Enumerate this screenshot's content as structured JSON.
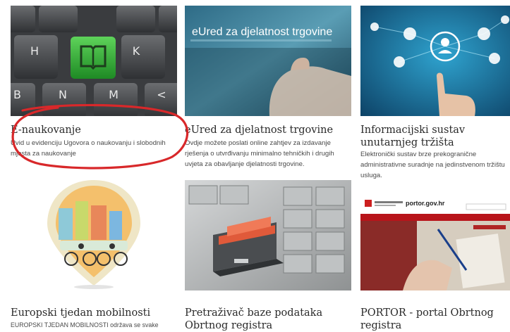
{
  "cards": [
    {
      "title": "E-naukovanje",
      "desc": "Uvid u evidenciju Ugovora o naukovanju i slobodnih mjesta za naukovanje",
      "keys": [
        "H",
        "K",
        "B",
        "N",
        "M",
        "<"
      ]
    },
    {
      "title": "eUred za djelatnost trgovine",
      "desc": "Ovdje možete poslati online zahtjev za izdavanje rješenja o utvrđivanju minimalno tehničkih i drugih uvjeta za obavljanje djelatnosti trgovine.",
      "image_text": "eUred za djelatnost trgovine"
    },
    {
      "title": "Informacijski sustav unutarnjeg tržišta",
      "desc": "Elektronički sustav brze prekogranične administrativne suradnje na jedinstvenom tržištu usluga."
    },
    {
      "title": "Europski tjedan mobilnosti",
      "desc": "EUROPSKI TJEDAN MOBILNOSTI održava se svake"
    },
    {
      "title": "Pretraživač baze podataka Obrtnog registra",
      "desc": ""
    },
    {
      "title": "PORTOR - portal Obrtnog registra",
      "desc": "",
      "image_text": "portor.gov.hr"
    }
  ],
  "colors": {
    "annotation": "#d8282a",
    "keyboard_green": "#3cae3c",
    "title_text": "#2a2a2a",
    "desc_text": "#4a4a4a"
  }
}
